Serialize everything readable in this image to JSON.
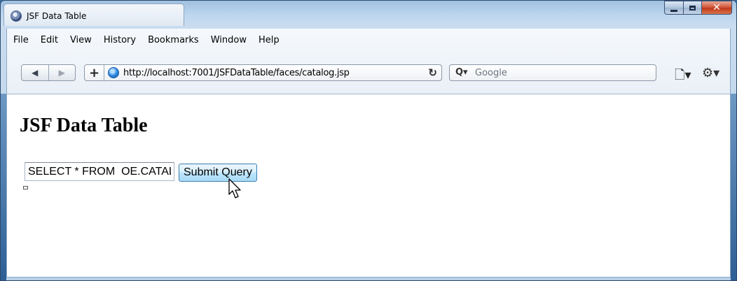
{
  "window": {
    "tab_title": "JSF Data Table",
    "controls": {
      "minimize": "minimize",
      "maximize": "maximize",
      "close": "✕"
    }
  },
  "menubar": [
    "File",
    "Edit",
    "View",
    "History",
    "Bookmarks",
    "Window",
    "Help"
  ],
  "toolbar": {
    "back_glyph": "◀",
    "forward_glyph": "▶",
    "add_glyph": "+",
    "url": "http://localhost:7001/JSFDataTable/faces/catalog.jsp",
    "reload_glyph": "↻",
    "search_icon": "Q▾",
    "search_placeholder": "Google",
    "page_menu_glyph": "🗋▾",
    "gear_menu_glyph": "⚙▾"
  },
  "page": {
    "heading": "JSF Data Table",
    "query_value": "SELECT * FROM  OE.CATALOG",
    "submit_label": "Submit Query"
  },
  "icons": {
    "app": "browser-icon",
    "site": "globe-icon",
    "search": "search-icon",
    "page": "page-menu-icon",
    "gear": "gear-icon",
    "cursor": "mouse-cursor-icon"
  },
  "colors": {
    "title_bar": "#bcd6ee",
    "close_button": "#c13a1a",
    "submit_button": "#bee6fd"
  }
}
